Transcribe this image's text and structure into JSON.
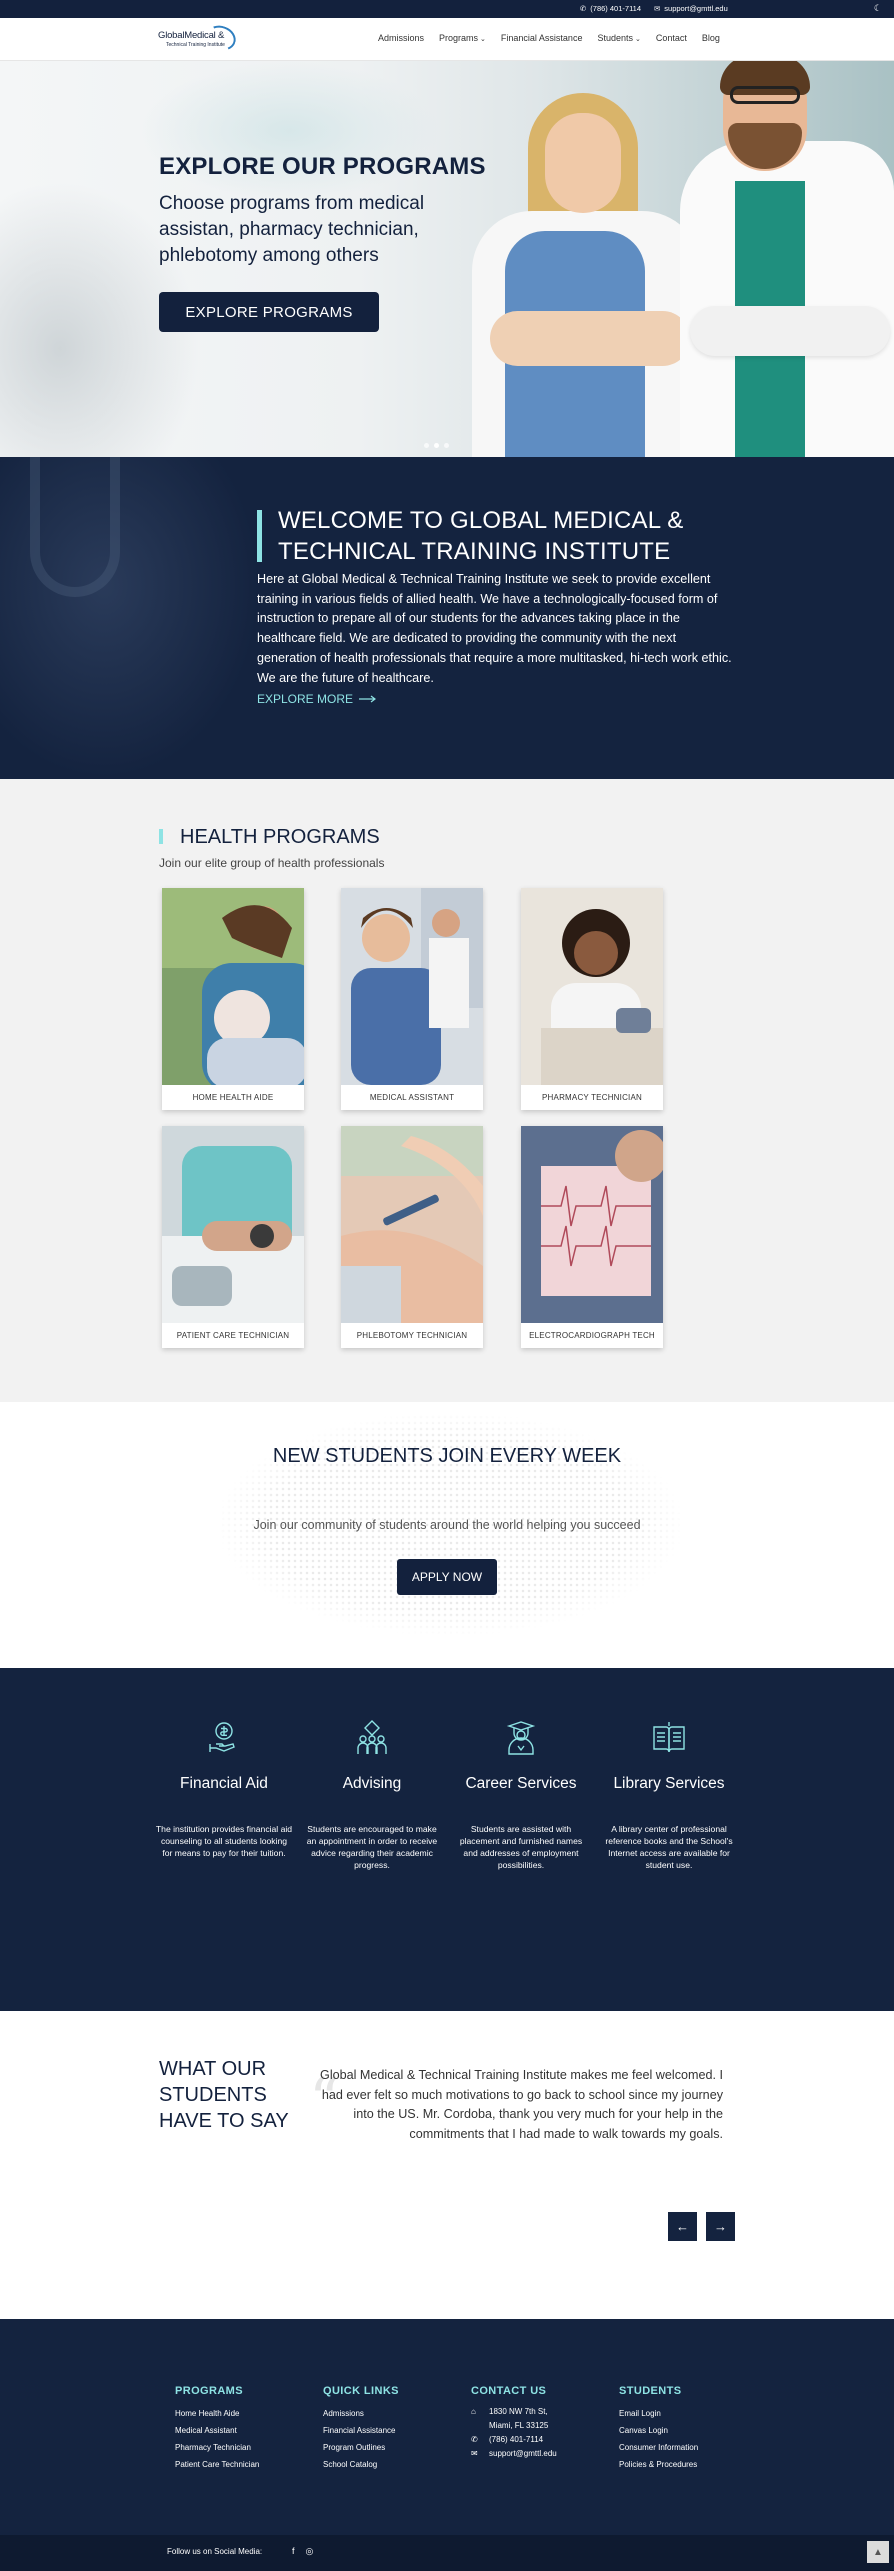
{
  "topbar": {
    "phone": "(786) 401-7114",
    "email": "support@gmttl.edu"
  },
  "logo": {
    "name": "GlobalMedical &",
    "tagline": "Technical Training Institute"
  },
  "nav": {
    "items": [
      {
        "label": "Admissions"
      },
      {
        "label": "Programs",
        "dropdown": true
      },
      {
        "label": "Financial Assistance"
      },
      {
        "label": "Students",
        "dropdown": true
      },
      {
        "label": "Contact"
      },
      {
        "label": "Blog"
      }
    ]
  },
  "hero": {
    "title": "EXPLORE OUR PROGRAMS",
    "subtitle": "Choose programs from medical assistan, pharmacy technician, phlebotomy among others",
    "button": "EXPLORE PROGRAMS"
  },
  "welcome": {
    "title": "WELCOME TO GLOBAL MEDICAL & TECHNICAL TRAINING INSTITUTE",
    "body": "Here at Global Medical & Technical Training Institute we seek to provide excellent training in various fields of allied health. We have a technologically-focused form of instruction to prepare all of our students for the advances taking place in the healthcare field. We are dedicated to providing the community with the next generation of health professionals that require a more multitasked, hi-tech work ethic. We are the future of healthcare.",
    "link": "EXPLORE MORE"
  },
  "programs": {
    "title": "HEALTH PROGRAMS",
    "subtitle": "Join our elite group of health professionals",
    "cards": [
      {
        "label": "HOME HEALTH AIDE"
      },
      {
        "label": "MEDICAL ASSISTANT"
      },
      {
        "label": "PHARMACY TECHNICIAN"
      },
      {
        "label": "PATIENT CARE TECHNICIAN"
      },
      {
        "label": "PHLEBOTOMY TECHNICIAN"
      },
      {
        "label": "ELECTROCARDIOGRAPH TECH"
      }
    ]
  },
  "join": {
    "title": "NEW STUDENTS JOIN EVERY WEEK",
    "text": "Join our community of students around the world helping you succeed",
    "button": "APPLY NOW"
  },
  "services": [
    {
      "icon": "hand-dollar-icon",
      "title": "Financial Aid",
      "text": "The institution provides financial aid counseling to all students looking for means to pay for their tuition."
    },
    {
      "icon": "people-advice-icon",
      "title": "Advising",
      "text": "Students are encouraged to make an appointment in order to receive advice regarding their academic progress."
    },
    {
      "icon": "graduate-icon",
      "title": "Career Services",
      "text": "Students are assisted with placement and furnished names and addresses of employment possibilities."
    },
    {
      "icon": "book-icon",
      "title": "Library Services",
      "text": "A library center of professional reference books and the School's Internet access are available for student use."
    }
  ],
  "testimonial": {
    "heading": "WHAT OUR STUDENTS HAVE TO SAY",
    "quote": "Global Medical & Technical Training Institute makes me feel welcomed. I had ever felt so much motivations to go back to school since my journey into the US. Mr. Cordoba, thank you very much for your help in the commitments that I had made to walk towards my goals."
  },
  "footer": {
    "programs": {
      "title": "PROGRAMS",
      "links": [
        "Home Health Aide",
        "Medical Assistant",
        "Pharmacy Technician",
        "Patient Care Technician"
      ]
    },
    "quick": {
      "title": "QUICK LINKS",
      "links": [
        "Admissions",
        "Financial Assistance",
        "Program Outlines",
        "School Catalog"
      ]
    },
    "contact": {
      "title": "CONTACT US",
      "address1": "1830 NW 7th St,",
      "address2": "Miami, FL 33125",
      "phone": "(786) 401-7114",
      "email": "support@gmttl.edu"
    },
    "students": {
      "title": "STUDENTS",
      "links": [
        "Email Login",
        "Canvas Login",
        "Consumer Information",
        "Policies & Procedures"
      ]
    },
    "social_label": "Follow us on Social Media:",
    "social": [
      "f",
      "◎"
    ]
  },
  "colors": {
    "navy": "#14233f",
    "accent": "#8ee3e4"
  }
}
